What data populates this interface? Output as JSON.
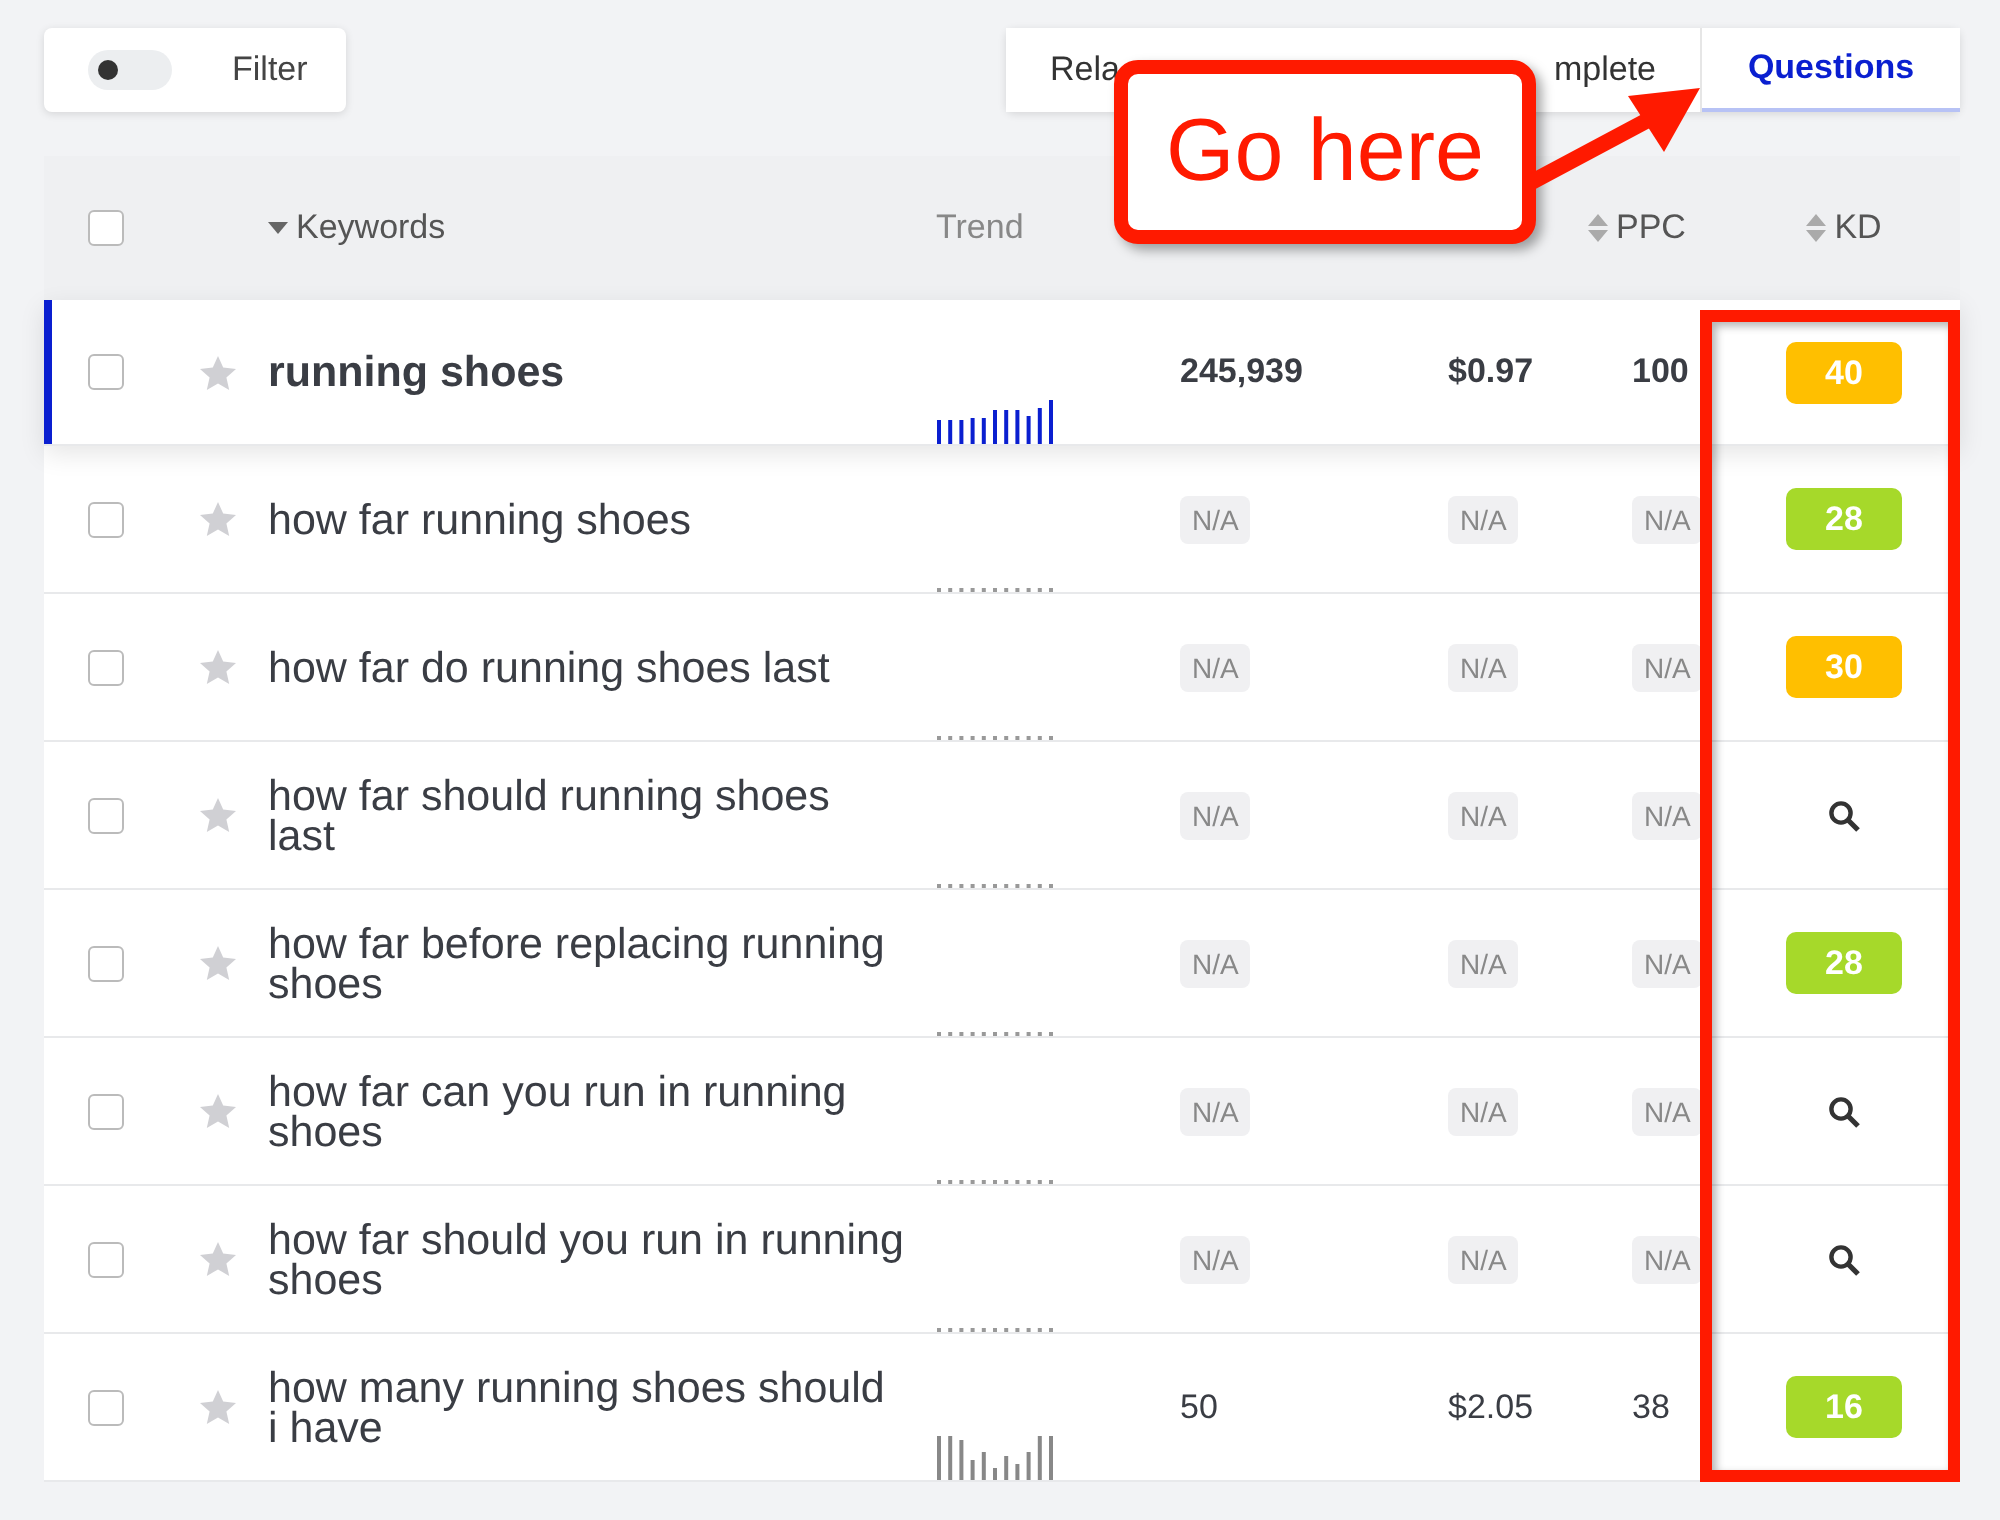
{
  "filter": {
    "label": "Filter",
    "on": false
  },
  "tabs": [
    {
      "label": "Rela",
      "selected": false
    },
    {
      "label": "mplete",
      "selected": false
    },
    {
      "label": "Questions",
      "selected": true
    }
  ],
  "table": {
    "columns": [
      {
        "label": "Keywords",
        "kind": "caret"
      },
      {
        "label": "Trend",
        "kind": "plain"
      },
      {
        "label": "PPC",
        "kind": "sortable"
      },
      {
        "label": "KD",
        "kind": "sortable"
      }
    ],
    "header_checked": false,
    "rows": [
      {
        "keyword": "running shoes",
        "selected": true,
        "checked": false,
        "trend": {
          "kind": "bars"
        },
        "volume": "245,939",
        "cpc": "$0.97",
        "ppc": "100",
        "na": false,
        "kd": {
          "kind": "score",
          "value": "40",
          "color": "#ffbf00"
        }
      },
      {
        "keyword": "how far running shoes",
        "selected": false,
        "checked": false,
        "trend": {
          "kind": "flat"
        },
        "volume": "N/A",
        "cpc": "N/A",
        "ppc": "N/A",
        "na": true,
        "kd": {
          "kind": "score",
          "value": "28",
          "color": "#a6d92a"
        }
      },
      {
        "keyword": "how far do running shoes last",
        "selected": false,
        "checked": false,
        "trend": {
          "kind": "flat"
        },
        "volume": "N/A",
        "cpc": "N/A",
        "ppc": "N/A",
        "na": true,
        "kd": {
          "kind": "score",
          "value": "30",
          "color": "#ffbf00"
        }
      },
      {
        "keyword": "how far should running shoes last",
        "selected": false,
        "checked": false,
        "trend": {
          "kind": "flat"
        },
        "volume": "N/A",
        "cpc": "N/A",
        "ppc": "N/A",
        "na": true,
        "kd": {
          "kind": "search"
        }
      },
      {
        "keyword": "how far before replacing running shoes",
        "selected": false,
        "checked": false,
        "trend": {
          "kind": "flat"
        },
        "volume": "N/A",
        "cpc": "N/A",
        "ppc": "N/A",
        "na": true,
        "kd": {
          "kind": "score",
          "value": "28",
          "color": "#a6d92a"
        }
      },
      {
        "keyword": "how far can you run in running shoes",
        "selected": false,
        "checked": false,
        "trend": {
          "kind": "flat"
        },
        "volume": "N/A",
        "cpc": "N/A",
        "ppc": "N/A",
        "na": true,
        "kd": {
          "kind": "search"
        }
      },
      {
        "keyword": "how far should you run in running shoes",
        "selected": false,
        "checked": false,
        "trend": {
          "kind": "flat"
        },
        "volume": "N/A",
        "cpc": "N/A",
        "ppc": "N/A",
        "na": true,
        "kd": {
          "kind": "search"
        }
      },
      {
        "keyword": "how many running shoes should i have",
        "selected": false,
        "checked": false,
        "trend": {
          "kind": "bars"
        },
        "volume": "50",
        "cpc": "$2.05",
        "ppc": "38",
        "na": false,
        "kd": {
          "kind": "score",
          "value": "16",
          "color": "#a6d92a"
        }
      }
    ]
  },
  "annotation": {
    "callout": "Go here"
  }
}
